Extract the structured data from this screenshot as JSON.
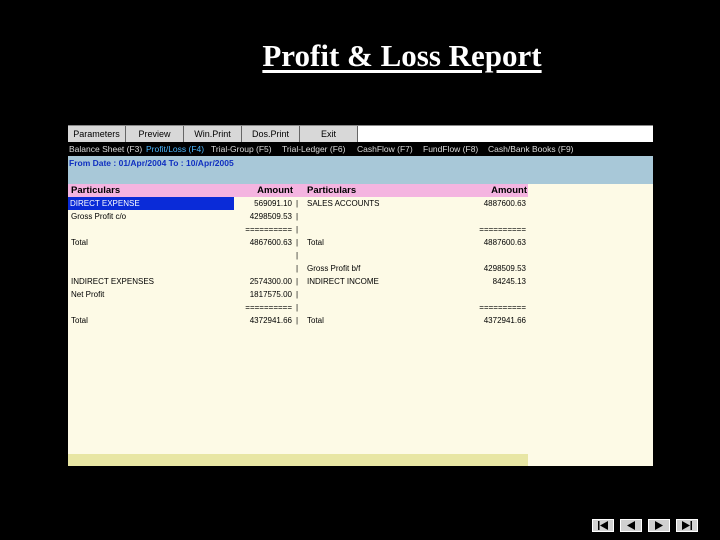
{
  "slide": {
    "title": "Profit & Loss Report"
  },
  "toolbar": [
    "Parameters",
    "Preview",
    "Win.Print",
    "Dos.Print",
    "Exit"
  ],
  "menu": [
    {
      "label": "Balance Sheet (F3)",
      "active": false
    },
    {
      "label": "Profit/Loss (F4)",
      "active": true
    },
    {
      "label": "Trial-Group (F5)",
      "active": false
    },
    {
      "label": "Trial-Ledger (F6)",
      "active": false
    },
    {
      "label": "CashFlow (F7)",
      "active": false
    },
    {
      "label": "FundFlow (F8)",
      "active": false
    },
    {
      "label": "Cash/Bank Books (F9)",
      "active": false
    }
  ],
  "date_range": "From Date : 01/Apr/2004 To : 10/Apr/2005",
  "table": {
    "headers": {
      "left_particulars": "Particulars",
      "left_amount": "Amount",
      "right_particulars": "Particulars",
      "right_amount": "Amount"
    },
    "rows": [
      {
        "lp": "DIRECT EXPENSE",
        "la": "569091.10",
        "sep": "|",
        "rp": "SALES ACCOUNTS",
        "ra": "4887600.63",
        "selected": true
      },
      {
        "lp": "Gross Profit c/o",
        "la": "4298509.53",
        "sep": "|",
        "rp": "",
        "ra": ""
      },
      {
        "lp": "",
        "la": "==========",
        "sep": "|",
        "rp": "",
        "ra": "=========="
      },
      {
        "lp": "Total",
        "la": "4867600.63",
        "sep": "|",
        "rp": "Total",
        "ra": "4887600.63"
      },
      {
        "lp": "",
        "la": "",
        "sep": "|",
        "rp": "",
        "ra": ""
      },
      {
        "lp": "",
        "la": "",
        "sep": "|",
        "rp": "Gross Profit b/f",
        "ra": "4298509.53"
      },
      {
        "lp": "INDIRECT EXPENSES",
        "la": "2574300.00",
        "sep": "|",
        "rp": "INDIRECT INCOME",
        "ra": "84245.13"
      },
      {
        "lp": "Net Profit",
        "la": "1817575.00",
        "sep": "|",
        "rp": "",
        "ra": ""
      },
      {
        "lp": "",
        "la": "==========",
        "sep": "|",
        "rp": "",
        "ra": "=========="
      },
      {
        "lp": "Total",
        "la": "4372941.66",
        "sep": "|",
        "rp": "Total",
        "ra": "4372941.66"
      }
    ]
  },
  "nav_buttons": [
    "first-icon",
    "prev-icon",
    "next-icon",
    "last-icon"
  ]
}
